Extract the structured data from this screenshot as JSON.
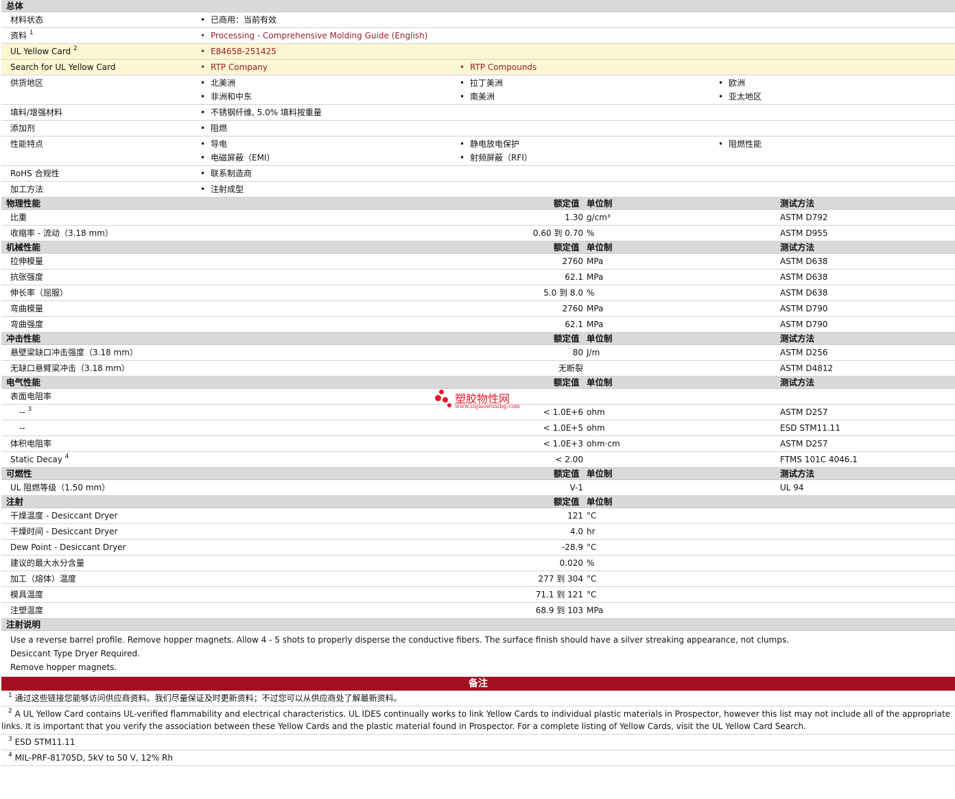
{
  "general": {
    "title": "总体",
    "status": {
      "label": "材料状态",
      "value": "已商用：当前有效"
    },
    "data": {
      "label": "资料",
      "sup": "1",
      "value": "Processing - Comprehensive Molding Guide (English)"
    },
    "ul_card": {
      "label": "UL Yellow Card",
      "sup": "2",
      "value": "E84658-251425"
    },
    "search_ul": {
      "label": "Search for UL Yellow Card",
      "v1": "RTP Company",
      "v2": "RTP Compounds"
    },
    "supply": {
      "label": "供货地区",
      "items": [
        "北美洲",
        "拉丁美洲",
        "欧洲",
        "非洲和中东",
        "南美洲",
        "亚太地区"
      ]
    },
    "filler": {
      "label": "填料/增强材料",
      "value": "不锈钢纤维, 5.0% 填料按重量"
    },
    "additive": {
      "label": "添加剂",
      "value": "阻燃"
    },
    "features": {
      "label": "性能特点",
      "items": [
        "导电",
        "静电放电保护",
        "阻燃性能",
        "电磁屏蔽（EMI）",
        "射频屏蔽（RFI）"
      ]
    },
    "rohs": {
      "label": "RoHS 合规性",
      "value": "联系制造商"
    },
    "processing": {
      "label": "加工方法",
      "value": "注射成型"
    }
  },
  "headers": {
    "rated": "额定值",
    "unit": "单位制",
    "method": "测试方法"
  },
  "physical": {
    "title": "物理性能",
    "rows": [
      {
        "label": "比重",
        "value": "1.30",
        "unit": "g/cm³",
        "method": "ASTM D792"
      },
      {
        "label": "收缩率  - 流动（3.18 mm）",
        "value": "0.60 到  0.70",
        "unit": "%",
        "method": "ASTM D955"
      }
    ]
  },
  "mechanical": {
    "title": "机械性能",
    "rows": [
      {
        "label": "拉伸模量",
        "value": "2760",
        "unit": "MPa",
        "method": "ASTM D638"
      },
      {
        "label": "抗张强度",
        "value": "62.1",
        "unit": "MPa",
        "method": "ASTM D638"
      },
      {
        "label": "伸长率（屈服）",
        "value": "5.0 到  8.0",
        "unit": "%",
        "method": "ASTM D638"
      },
      {
        "label": "弯曲模量",
        "value": "2760",
        "unit": "MPa",
        "method": "ASTM D790"
      },
      {
        "label": "弯曲强度",
        "value": "62.1",
        "unit": "MPa",
        "method": "ASTM D790"
      }
    ]
  },
  "impact": {
    "title": "冲击性能",
    "rows": [
      {
        "label": "悬壁梁缺口冲击强度（3.18 mm）",
        "value": "80",
        "unit": "J/m",
        "method": "ASTM D256"
      },
      {
        "label": "无缺口悬臂梁冲击（3.18 mm）",
        "value": "无断裂",
        "unit": "",
        "method": "ASTM D4812"
      }
    ]
  },
  "electrical": {
    "title": "电气性能",
    "surface": "表面电阻率",
    "rows": [
      {
        "label": "--",
        "sup": "3",
        "value": "< 1.0E+6",
        "unit": "ohm",
        "method": "ASTM D257"
      },
      {
        "label": "--",
        "sup": "",
        "value": "< 1.0E+5",
        "unit": "ohm",
        "method": "ESD STM11.11"
      },
      {
        "label": "体积电阻率",
        "sup": "",
        "value": "< 1.0E+3",
        "unit": "ohm·cm",
        "method": "ASTM D257"
      },
      {
        "label": "Static Decay",
        "sup": "4",
        "value": "< 2.00",
        "unit": "",
        "method": "FTMS 101C 4046.1"
      }
    ]
  },
  "flammability": {
    "title": "可燃性",
    "rows": [
      {
        "label": "UL 阻燃等级（1.50 mm）",
        "value": "V-1",
        "unit": "",
        "method": "UL 94"
      }
    ]
  },
  "injection": {
    "title": "注射",
    "rows": [
      {
        "label": "干燥温度  - Desiccant Dryer",
        "value": "121",
        "unit": "°C"
      },
      {
        "label": "干燥时间  - Desiccant Dryer",
        "value": "4.0",
        "unit": "hr"
      },
      {
        "label": "Dew Point - Desiccant Dryer",
        "value": "-28.9",
        "unit": "°C"
      },
      {
        "label": "建议的最大水分含量",
        "value": "0.020",
        "unit": "%"
      },
      {
        "label": "加工（熔体）温度",
        "value": "277 到  304",
        "unit": "°C"
      },
      {
        "label": "模具温度",
        "value": "71.1 到  121",
        "unit": "°C"
      },
      {
        "label": "注塑温度",
        "value": "68.9 到  103",
        "unit": "MPa"
      }
    ]
  },
  "injection_notes": {
    "title": "注射说明",
    "lines": [
      "Use a reverse barrel profile. Remove hopper magnets. Allow 4 - 5 shots to properly disperse the conductive fibers. The surface finish should have a silver streaking appearance, not clumps.",
      "Desiccant Type Dryer Required.",
      "Remove hopper magnets."
    ]
  },
  "remarks": {
    "title": "备注",
    "footnotes": [
      {
        "n": "1",
        "text": "通过这些链接您能够访问供应商资料。我们尽量保证及时更新资料；不过您可以从供应商处了解最新资料。"
      },
      {
        "n": "2",
        "text": "A UL Yellow Card contains UL-verified flammability and electrical characteristics. UL IDES continually works to link Yellow Cards to individual plastic materials in Prospector, however this list may not include all of the appropriate links. It is important that you verify the association between these Yellow Cards and the plastic material found in Prospector. For a complete listing of Yellow Cards, visit the UL Yellow Card Search."
      },
      {
        "n": "3",
        "text": "ESD STM11.11"
      },
      {
        "n": "4",
        "text": "MIL-PRF-81705D, 5kV to 50 V, 12% Rh"
      }
    ]
  },
  "watermark": {
    "cn": "塑胶物性网",
    "url": "www.sujiaowuxing.com",
    "color": "#e21b2d"
  },
  "colors": {
    "section_bg": "#d9d9d9",
    "highlight_bg": "#fbf7d3",
    "link": "#9a1d2b",
    "remark_bar": "#a31020"
  }
}
